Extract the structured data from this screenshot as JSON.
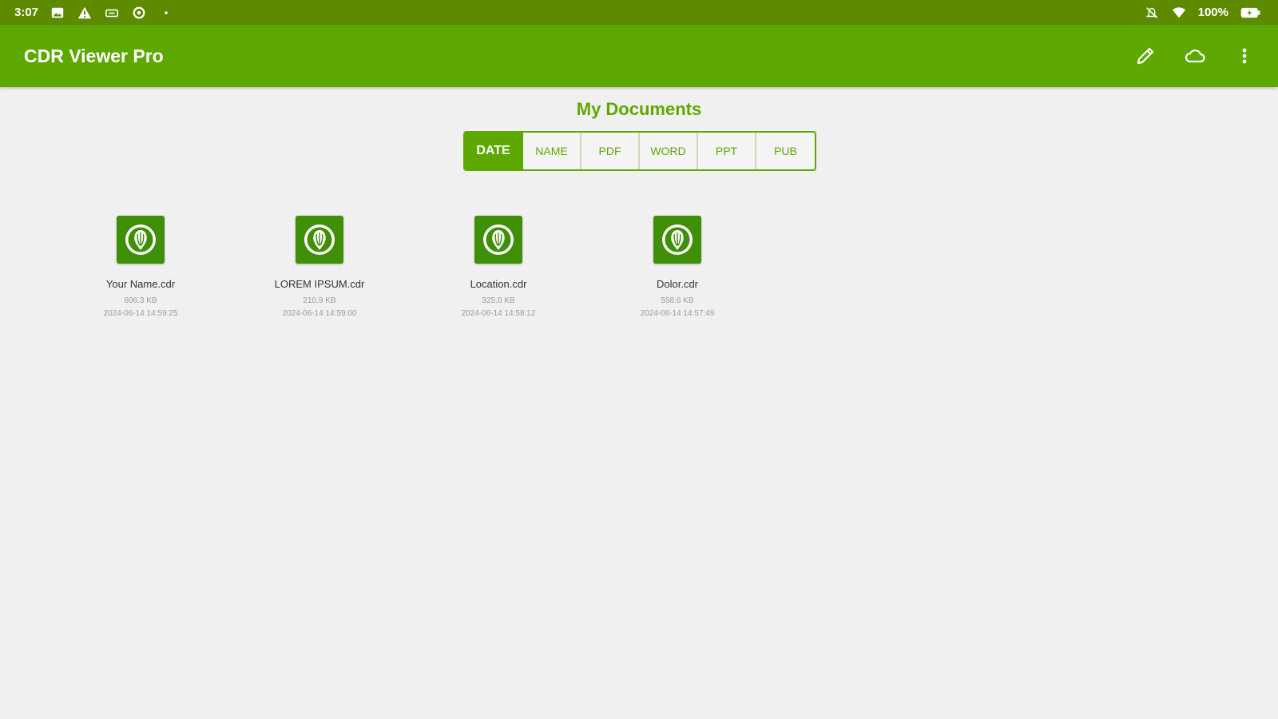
{
  "status_bar": {
    "time": "3:07",
    "battery": "100%",
    "left_icons": [
      "image-icon",
      "warning-icon",
      "cast-icon",
      "sync-icon",
      "dot-icon"
    ],
    "right_icons": [
      "mute-icon",
      "wifi-icon",
      "battery-icon"
    ]
  },
  "app_bar": {
    "title": "CDR Viewer Pro",
    "actions": [
      "edit-icon",
      "cloud-icon",
      "more-vert-icon"
    ]
  },
  "section_title": "My Documents",
  "filters": [
    {
      "label": "DATE",
      "active": true
    },
    {
      "label": "NAME",
      "active": false
    },
    {
      "label": "PDF",
      "active": false
    },
    {
      "label": "WORD",
      "active": false
    },
    {
      "label": "PPT",
      "active": false
    },
    {
      "label": "PUB",
      "active": false
    }
  ],
  "files": [
    {
      "name": "Your Name.cdr",
      "size": "606.3 KB",
      "date": "2024-06-14 14:59:25"
    },
    {
      "name": "LOREM IPSUM.cdr",
      "size": "210.9 KB",
      "date": "2024-06-14 14:59:00"
    },
    {
      "name": "Location.cdr",
      "size": "325.0 KB",
      "date": "2024-06-14 14:58:12"
    },
    {
      "name": "Dolor.cdr",
      "size": "558.6 KB",
      "date": "2024-06-14 14:57:49"
    }
  ],
  "colors": {
    "status_bar": "#5e8a00",
    "app_bar": "#5ea802",
    "accent": "#5ea802",
    "file_icon": "#3f8f08",
    "background": "#f0f0f0"
  }
}
